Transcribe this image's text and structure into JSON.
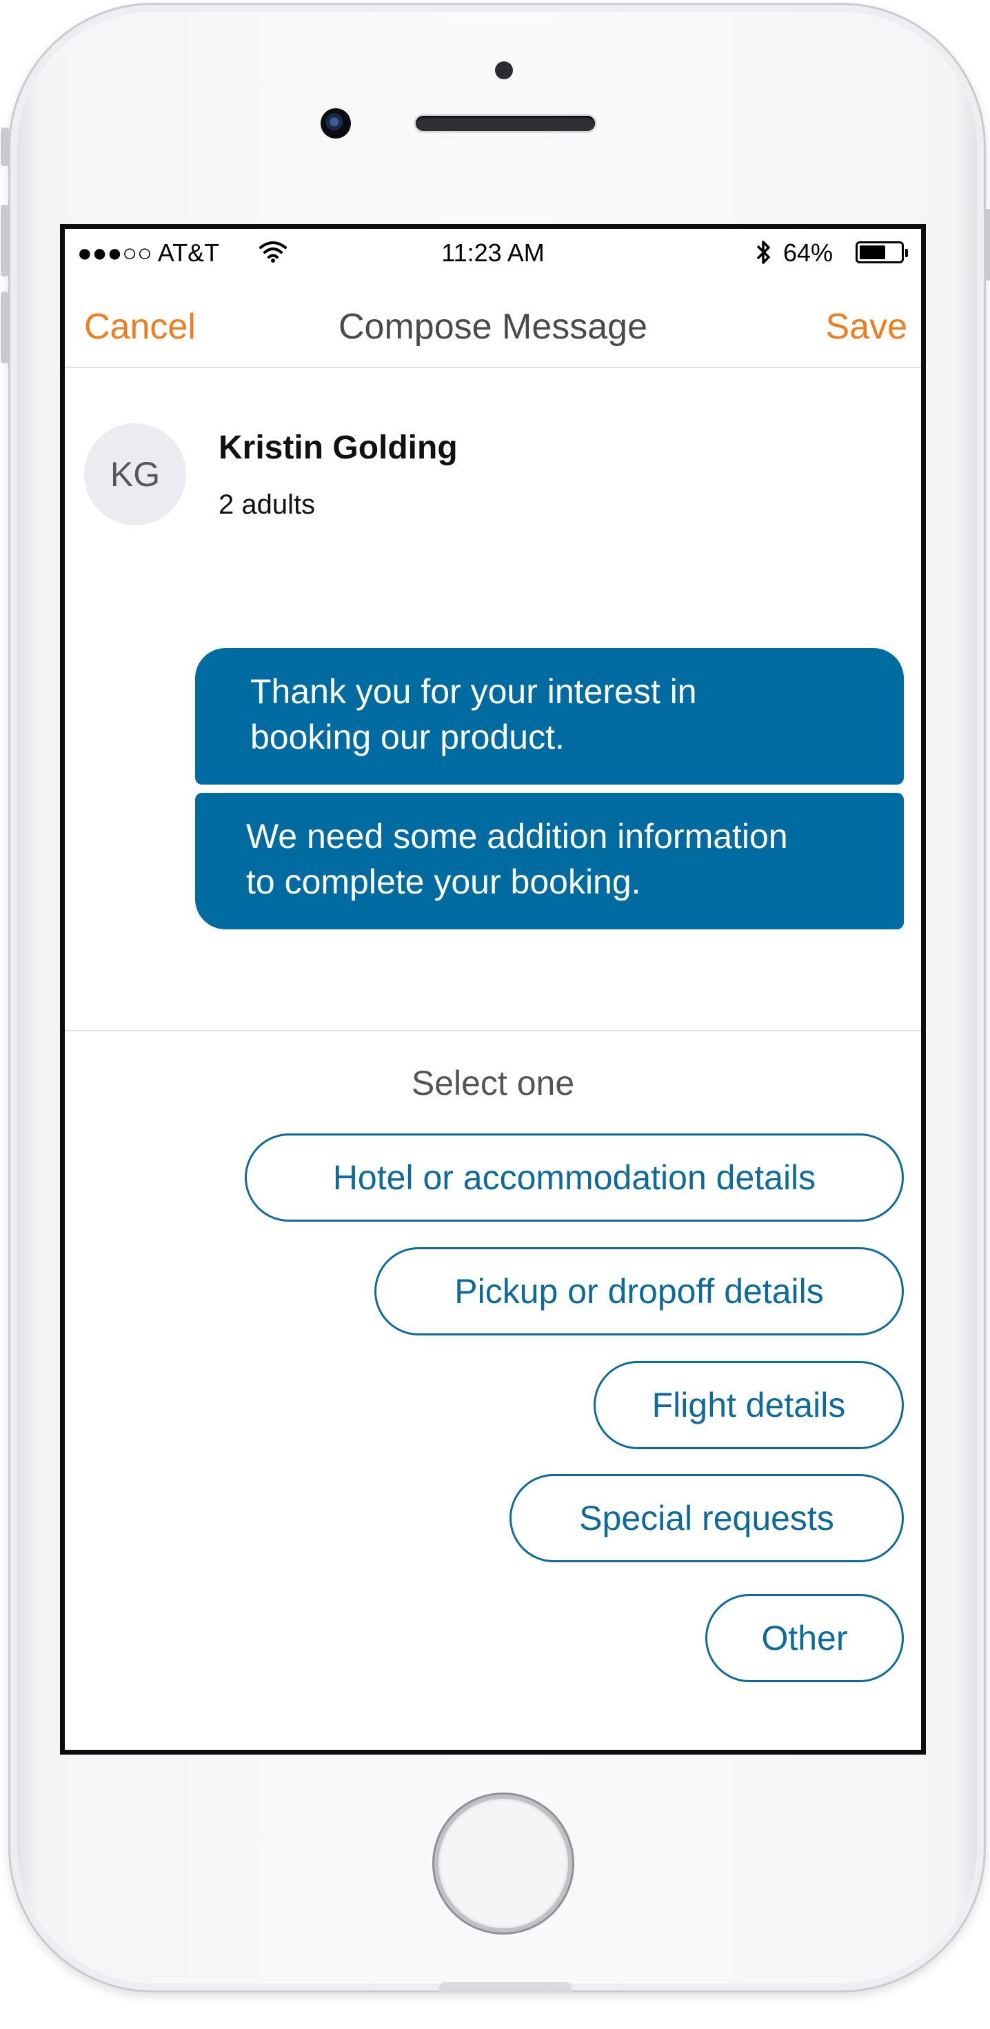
{
  "status_bar": {
    "carrier": "●●●○○ AT&T",
    "time": "11:23 AM",
    "battery_percent": "64%",
    "battery_level": 0.64
  },
  "navbar": {
    "cancel_label": "Cancel",
    "title": "Compose Message",
    "save_label": "Save"
  },
  "contact": {
    "initials": "KG",
    "name": "Kristin Golding",
    "party": "2 adults"
  },
  "messages": [
    {
      "line1": "Thank you for your interest in",
      "line2": "booking our product."
    },
    {
      "line1": "We need some addition information",
      "line2": "to complete your booking."
    }
  ],
  "prompt": "Select one",
  "options": [
    "Hotel or accommodation details",
    "Pickup or dropoff details",
    "Flight details",
    "Special requests",
    "Other"
  ],
  "colors": {
    "accent_orange": "#ef7d1e",
    "bubble_blue": "#006ba0",
    "option_blue": "#0d6a9c"
  }
}
